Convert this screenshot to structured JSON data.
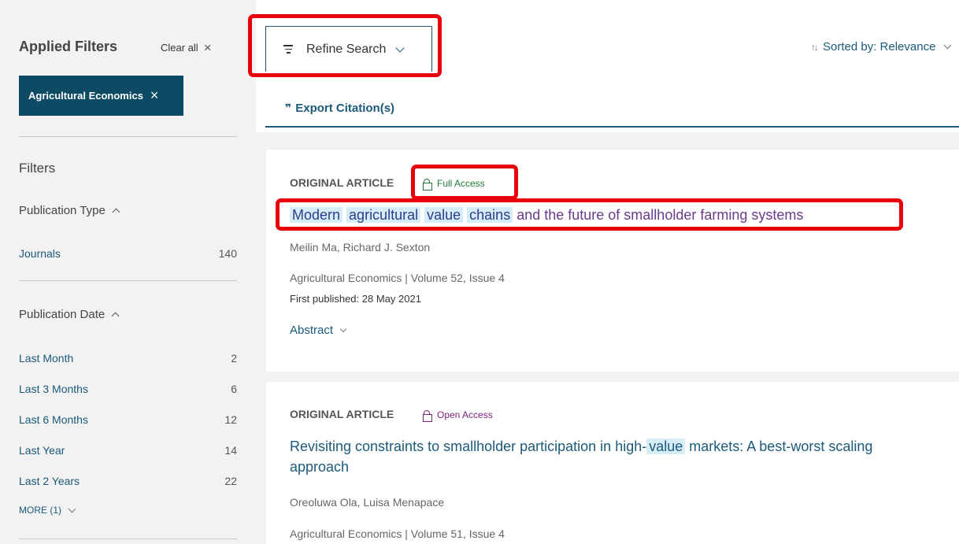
{
  "sidebar": {
    "applied_title": "Applied Filters",
    "clear_all": "Clear all",
    "chip_label": "Agricultural Economics",
    "filters_title": "Filters",
    "pub_type_label": "Publication Type",
    "pub_type_items": [
      {
        "label": "Journals",
        "count": "140"
      }
    ],
    "pub_date_label": "Publication Date",
    "pub_date_items": [
      {
        "label": "Last Month",
        "count": "2"
      },
      {
        "label": "Last 3 Months",
        "count": "6"
      },
      {
        "label": "Last 6 Months",
        "count": "12"
      },
      {
        "label": "Last Year",
        "count": "14"
      },
      {
        "label": "Last 2 Years",
        "count": "22"
      }
    ],
    "more": "MORE (1)"
  },
  "toolbar": {
    "refine_label": "Refine Search",
    "sorted_label": "Sorted by: Relevance",
    "export_label": "Export Citation(s)"
  },
  "results": [
    {
      "type": "ORIGINAL ARTICLE",
      "access": "Full Access",
      "title_words": [
        "Modern",
        "agricultural",
        "value",
        "chains"
      ],
      "title_rest": "and the future of smallholder farming systems",
      "authors": "Meilin Ma, Richard J. Sexton",
      "journal": "Agricultural Economics | Volume 52, Issue 4",
      "published": "First published: 28 May 2021",
      "abstract_label": "Abstract"
    },
    {
      "type": "ORIGINAL ARTICLE",
      "access": "Open Access",
      "title_pre": "Revisiting constraints to smallholder participation in high-",
      "title_hl": "value",
      "title_post": "markets: A best-worst scaling approach",
      "authors": "Oreoluwa Ola, Luisa Menapace",
      "journal": "Agricultural Economics | Volume 51, Issue 4"
    }
  ],
  "colors": {
    "accent": "#1b5a7a",
    "chip_bg": "#0d4a64",
    "full_access": "#1f7a3a",
    "open_access": "#7a1f7a",
    "highlight": "#d6ecf7",
    "annotation_red": "#e8000b"
  },
  "icons": [
    "close-icon",
    "chevron-up-icon",
    "chevron-down-icon",
    "filter-lines-icon",
    "sort-arrows-icon",
    "quote-icon",
    "lock-icon"
  ]
}
